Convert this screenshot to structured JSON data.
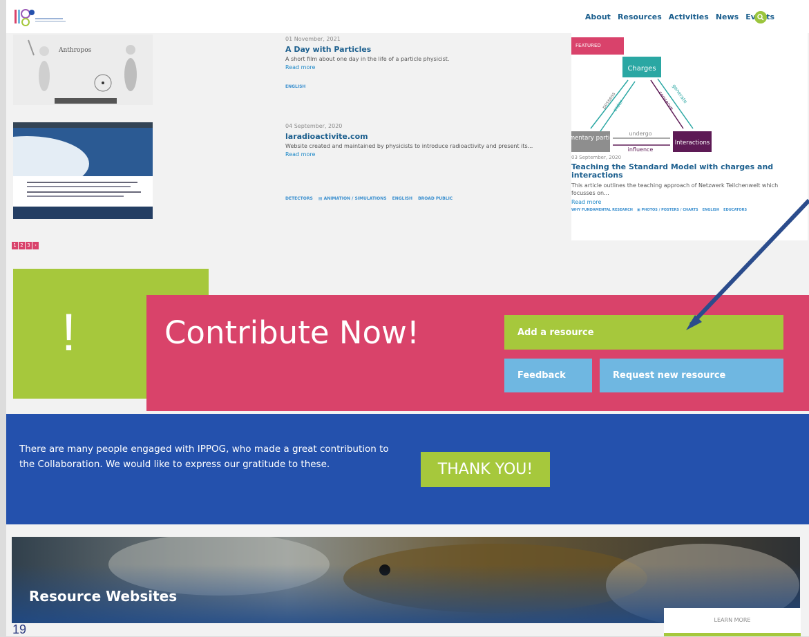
{
  "nav": {
    "items": [
      "About",
      "Resources",
      "Activities",
      "News",
      "Events"
    ],
    "search_icon": "search-icon"
  },
  "articles": [
    {
      "date": "01 November, 2021",
      "title": "A Day with Particles",
      "description": "A short film about one day in the life of a particle physicist.",
      "read_more": "Read more",
      "tags": [
        "ENGLISH"
      ]
    },
    {
      "date": "04 September, 2020",
      "title": "laradioactivite.com",
      "description": "Website created and maintained by physicists to introduce radioactivity and present its...",
      "read_more": "Read more",
      "tags": [
        "DETECTORS",
        "ANIMATION / SIMULATIONS",
        "ENGLISH",
        "BROAD PUBLIC"
      ]
    }
  ],
  "thumb1_caption": "Anthropos",
  "featured": {
    "label": "FEATURED",
    "diagram": {
      "charges": "Charges",
      "elementary": "Elementary particles",
      "interactions": "Interactions",
      "possess": "possess",
      "order": "order",
      "generate": "generate",
      "conserve": "conserve",
      "undergo": "undergo",
      "influence": "influence"
    },
    "date": "03 September, 2020",
    "title": "Teaching the Standard Model with charges and interactions",
    "description": "This article outlines the teaching approach of Netzwerk Teilchenwelt which focusses on...",
    "read_more": "Read more",
    "tags": [
      "WHY FUNDAMENTAL RESEARCH",
      "PHOTOS / POSTERS / CHARTS",
      "ENGLISH",
      "EDUCATORS"
    ]
  },
  "pager": [
    "1",
    "2",
    "3"
  ],
  "contribute": {
    "exclamation": "!",
    "title": "Contribute Now!",
    "add_resource": "Add a resource",
    "feedback": "Feedback",
    "request": "Request new resource"
  },
  "thanks": {
    "text": "There are many people engaged with IPPOG, who made a great contribution to the Collaboration. We would like to express our gratitude to these.",
    "button": "THANK YOU!"
  },
  "resource_websites": {
    "title": "Resource Websites",
    "learn_more": "LEARN MORE"
  },
  "slide_number": "19",
  "colors": {
    "pink": "#d9436a",
    "green": "#a6c83c",
    "blue": "#2451ad",
    "light_blue": "#6fb7e1",
    "arrow": "#2b4c8c"
  }
}
